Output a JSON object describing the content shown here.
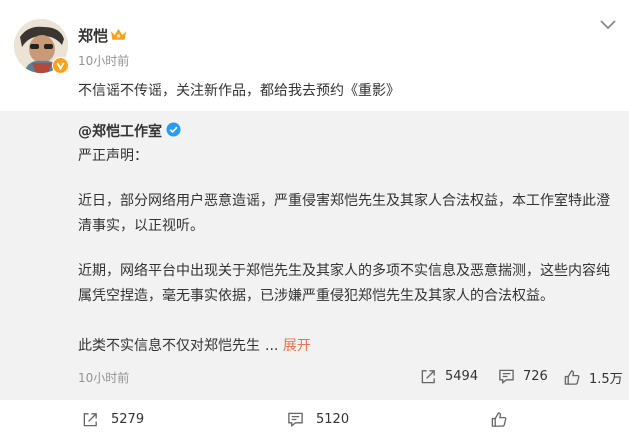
{
  "post": {
    "username": "郑恺",
    "time": "10小时前",
    "text": "不信谣不传谣，关注新作品，都给我去预约《重影》"
  },
  "retweet": {
    "author": "@郑恺工作室",
    "lines": [
      "严正声明：",
      "近日，部分网络用户恶意造谣，严重侵害郑恺先生及其家人合法权益，本工作室特此澄",
      "清事实，以正视听。",
      "近期，网络平台中出现关于郑恺先生及其家人的多项不实信息及恶意揣测，这些内容纯",
      "属凭空捏造，毫无事实依据，已涉嫌严重侵犯郑恺先生及其家人的合法权益。",
      "此类不实信息不仅对郑恺先生"
    ],
    "ellipsis": " ...",
    "expand_label": "展开",
    "time": "10小时前",
    "share_count": "5494",
    "comment_count": "726",
    "like_count": "1.5万"
  },
  "actions": {
    "share_count": "5279",
    "comment_count": "5120"
  },
  "icons": {
    "verified_badge": "verified-v-icon",
    "crown": "crown-icon",
    "chevron": "chevron-down-icon",
    "share": "share-icon",
    "comment": "comment-icon",
    "like": "thumbs-up-icon"
  },
  "colors": {
    "expand": "#eb7350",
    "verified_blue": "#2a9bf5",
    "verified_orange": "#f7a21d",
    "muted": "#939393"
  }
}
